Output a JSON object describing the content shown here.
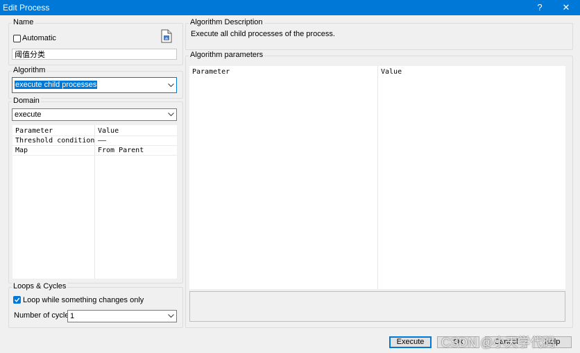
{
  "window": {
    "title": "Edit Process",
    "help_glyph": "?",
    "close_glyph": "✕"
  },
  "name_group": {
    "label": "Name",
    "automatic_label": "Automatic",
    "automatic_checked": false,
    "name_value": "阈值分类"
  },
  "algorithm_group": {
    "label": "Algorithm",
    "selected": "execute child processes"
  },
  "domain_group": {
    "label": "Domain",
    "selected": "execute",
    "grid": {
      "headers": [
        "Parameter",
        "Value"
      ],
      "rows": [
        [
          "Threshold condition",
          "——"
        ],
        [
          "Map",
          "From Parent"
        ]
      ]
    }
  },
  "loops_group": {
    "label": "Loops & Cycles",
    "loop_label": "Loop while something changes only",
    "loop_checked": true,
    "cycles_label": "Number of cycles",
    "cycles_value": "1"
  },
  "description_group": {
    "label": "Algorithm Description",
    "text": "Execute all child processes of the process."
  },
  "parameters_group": {
    "label": "Algorithm parameters",
    "headers": [
      "Parameter",
      "Value"
    ]
  },
  "buttons": {
    "execute": "Execute",
    "ok": "Ok",
    "cancel": "Cancel",
    "help": "Help"
  },
  "watermark": "CSDN @小天学代码",
  "colors": {
    "titlebar": "#0078d7",
    "selection": "#0078d7",
    "background": "#f0f0f0"
  }
}
